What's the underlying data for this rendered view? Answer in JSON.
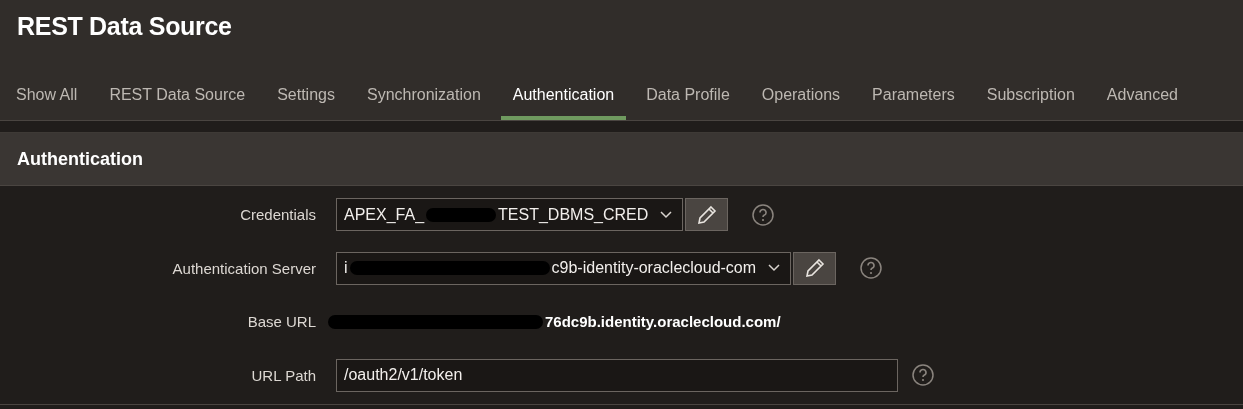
{
  "page_title": "REST Data Source",
  "tabs": [
    {
      "label": "Show All",
      "selected": false
    },
    {
      "label": "REST Data Source",
      "selected": false
    },
    {
      "label": "Settings",
      "selected": false
    },
    {
      "label": "Synchronization",
      "selected": false
    },
    {
      "label": "Authentication",
      "selected": true
    },
    {
      "label": "Data Profile",
      "selected": false
    },
    {
      "label": "Operations",
      "selected": false
    },
    {
      "label": "Parameters",
      "selected": false
    },
    {
      "label": "Subscription",
      "selected": false
    },
    {
      "label": "Advanced",
      "selected": false
    }
  ],
  "section": {
    "title": "Authentication",
    "fields": [
      {
        "kind": "select",
        "label": "Credentials",
        "value_parts": [
          {
            "kind": "text",
            "text": "APEX_FA_"
          },
          {
            "kind": "redaction"
          },
          {
            "kind": "text",
            "text": "TEST_DBMS_CRED"
          }
        ],
        "edit_button": true,
        "help": true
      },
      {
        "kind": "select",
        "label": "Authentication Server",
        "value_parts": [
          {
            "kind": "text",
            "text": "i"
          },
          {
            "kind": "redaction"
          },
          {
            "kind": "text",
            "text": "c9b-identity-oraclecloud-com"
          }
        ],
        "edit_button": true,
        "help": true
      },
      {
        "kind": "display",
        "label": "Base URL",
        "value_parts": [
          {
            "kind": "redaction"
          },
          {
            "kind": "text",
            "text": "76dc9b.identity.oraclecloud.com/"
          }
        ],
        "edit_button": false,
        "help": false
      },
      {
        "kind": "text",
        "label": "URL Path",
        "value_parts": [
          {
            "kind": "text",
            "text": "/oauth2/v1/token"
          }
        ],
        "edit_button": false,
        "help": true
      }
    ]
  }
}
